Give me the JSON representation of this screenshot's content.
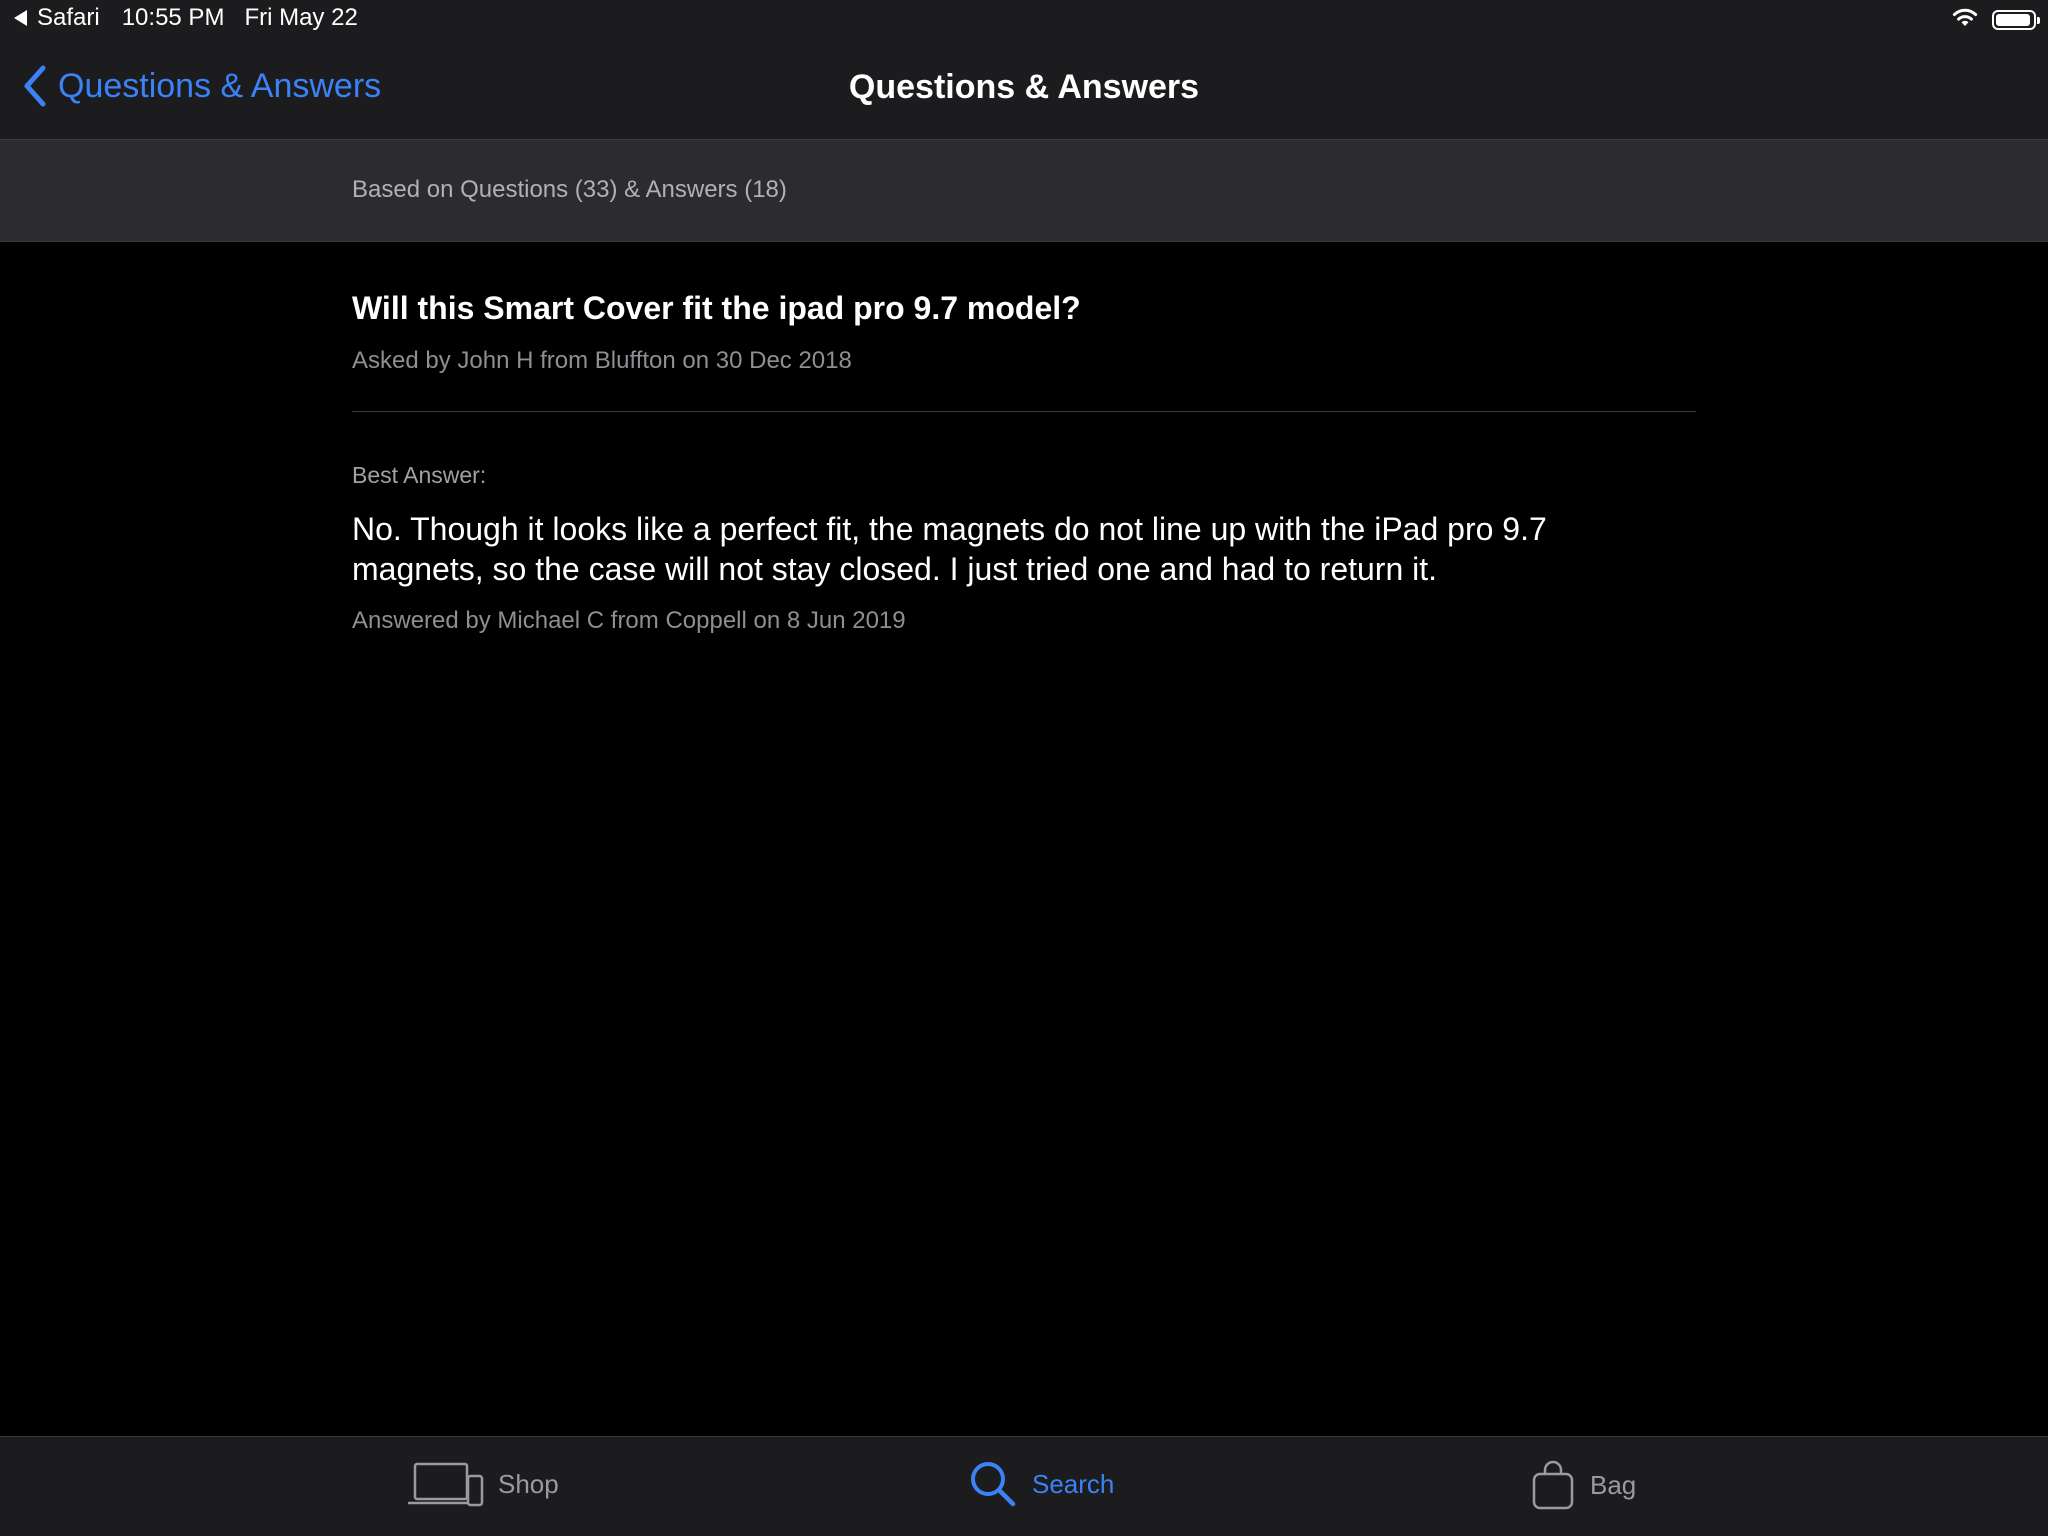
{
  "status_bar": {
    "back_app": "Safari",
    "time": "10:55 PM",
    "date": "Fri May 22",
    "battery_level": 0.95
  },
  "nav": {
    "back_label": "Questions & Answers",
    "title": "Questions & Answers"
  },
  "summary": {
    "text": "Based on Questions (33) & Answers (18)"
  },
  "question": {
    "title": "Will this Smart Cover fit the ipad pro 9.7 model?",
    "asked_by": "Asked by John H from Bluffton on 30 Dec 2018"
  },
  "answer": {
    "label": "Best Answer:",
    "text": "No. Though it looks like a perfect fit, the magnets do not line up with the iPad pro 9.7 magnets, so the case will not stay closed.  I just tried one and had to return it.",
    "answered_by": "Answered by Michael C from Coppell on 8 Jun 2019"
  },
  "tab_bar": {
    "tabs": [
      {
        "label": "Shop",
        "icon": "devices-icon",
        "active": false
      },
      {
        "label": "Search",
        "icon": "search-icon",
        "active": true
      },
      {
        "label": "Bag",
        "icon": "bag-icon",
        "active": false
      }
    ]
  },
  "colors": {
    "accent": "#3b82f6",
    "bar_background": "#1c1c1e",
    "summary_background": "#2c2c2e",
    "content_background": "#000000"
  }
}
